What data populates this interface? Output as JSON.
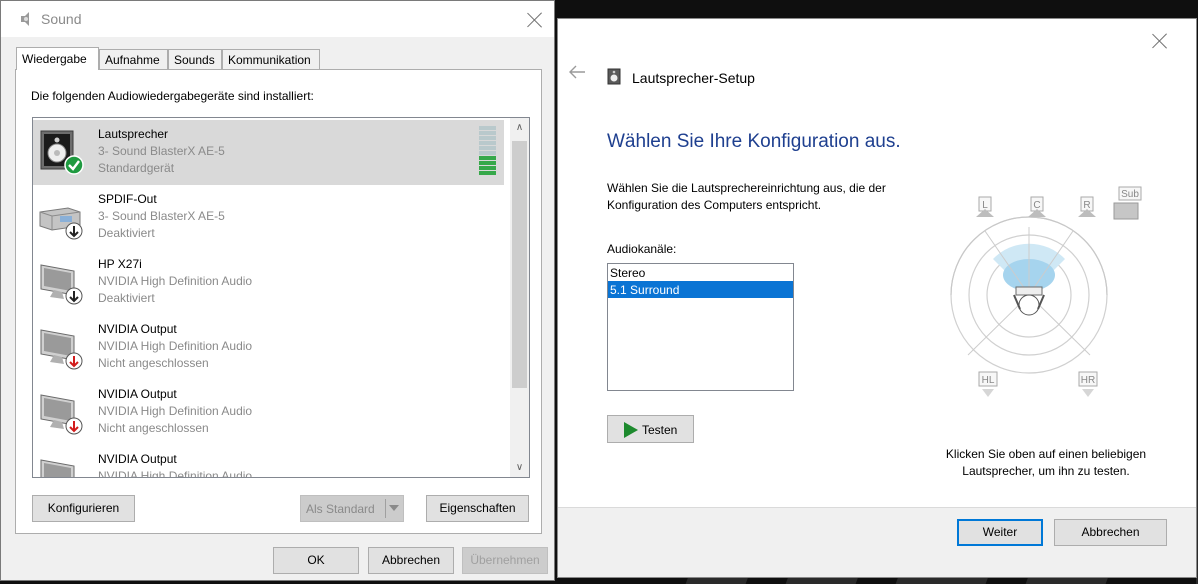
{
  "sound_dialog": {
    "title": "Sound",
    "tabs": [
      {
        "label": "Wiedergabe",
        "active": true
      },
      {
        "label": "Aufnahme",
        "active": false
      },
      {
        "label": "Sounds",
        "active": false
      },
      {
        "label": "Kommunikation",
        "active": false
      }
    ],
    "intro": "Die folgenden Audiowiedergabegeräte sind installiert:",
    "devices": [
      {
        "name": "Lautsprecher",
        "driver": "3- Sound BlasterX AE-5",
        "status": "Standardgerät",
        "icon": "speaker-icon",
        "badge": "default-check-icon",
        "selected": true,
        "level_segments_on": 4,
        "level_segments_total": 10
      },
      {
        "name": "SPDIF-Out",
        "driver": "3- Sound BlasterX AE-5",
        "status": "Deaktiviert",
        "icon": "digital-output-icon",
        "badge": "disabled-arrow-icon"
      },
      {
        "name": "HP X27i",
        "driver": "NVIDIA High Definition Audio",
        "status": "Deaktiviert",
        "icon": "monitor-icon",
        "badge": "disabled-arrow-icon"
      },
      {
        "name": "NVIDIA Output",
        "driver": "NVIDIA High Definition Audio",
        "status": "Nicht angeschlossen",
        "icon": "monitor-icon",
        "badge": "unplugged-arrow-icon"
      },
      {
        "name": "NVIDIA Output",
        "driver": "NVIDIA High Definition Audio",
        "status": "Nicht angeschlossen",
        "icon": "monitor-icon",
        "badge": "unplugged-arrow-icon"
      },
      {
        "name": "NVIDIA Output",
        "driver": "NVIDIA High Definition Audio",
        "status": "",
        "icon": "monitor-icon",
        "badge": ""
      }
    ],
    "buttons": {
      "configure": "Konfigurieren",
      "set_default": "Als Standard",
      "properties": "Eigenschaften",
      "ok": "OK",
      "cancel": "Abbrechen",
      "apply": "Übernehmen"
    }
  },
  "setup_dialog": {
    "title": "Lautsprecher-Setup",
    "heading": "Wählen Sie Ihre Konfiguration aus.",
    "description": "Wählen Sie die Lautsprechereinrichtung aus, die der Konfiguration des Computers entspricht.",
    "channels_label": "Audiokanäle:",
    "channels": [
      {
        "label": "Stereo",
        "selected": false
      },
      {
        "label": "5.1 Surround",
        "selected": true
      }
    ],
    "test_button": "Testen",
    "speaker_labels": {
      "left": "L",
      "center": "C",
      "right": "R",
      "sub": "Sub",
      "rear_left": "HL",
      "rear_right": "HR"
    },
    "hint": "Klicken Sie oben auf einen beliebigen Lautsprecher, um ihn zu testen.",
    "buttons": {
      "next": "Weiter",
      "cancel": "Abbrechen"
    }
  },
  "colors": {
    "accent": "#0078d7",
    "selection": "#0a74d4",
    "heading": "#1e3f8f",
    "level_on": "#36a84a"
  }
}
